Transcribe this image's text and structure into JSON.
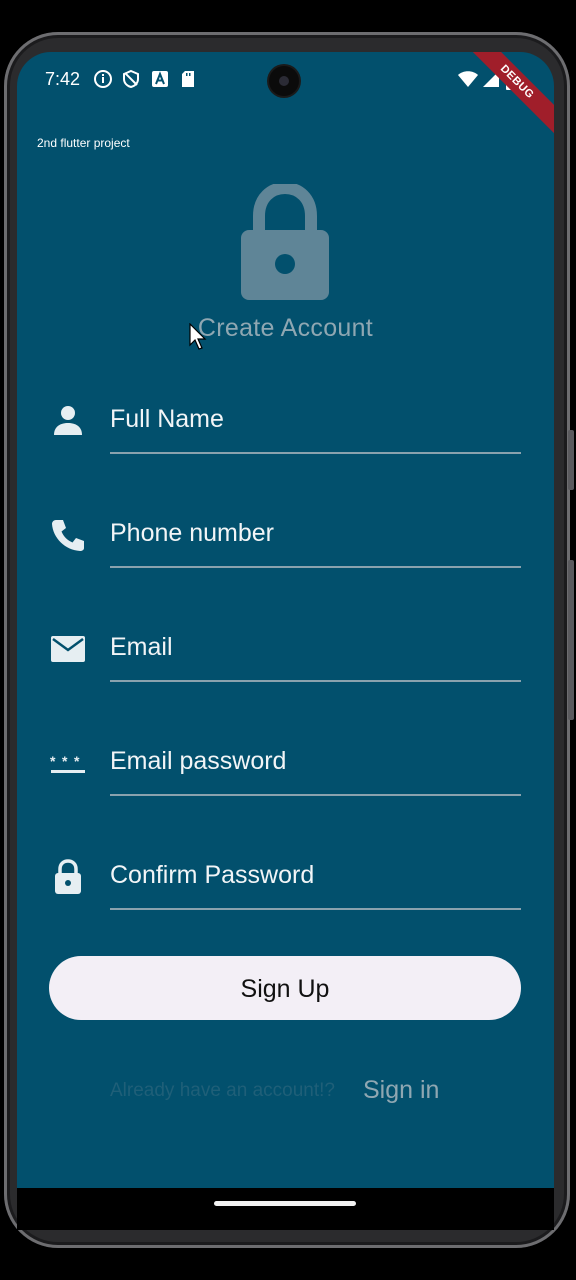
{
  "status_bar": {
    "time": "7:42",
    "left_icons": [
      "info-icon",
      "shield-icon",
      "a-icon",
      "sd-card-icon"
    ],
    "right_icons": [
      "wifi-icon",
      "signal-icon",
      "battery-icon"
    ]
  },
  "debug_banner": "DEBUG",
  "app": {
    "title": "2nd flutter project",
    "heading": "Create Account",
    "fields": [
      {
        "label": "Full Name",
        "icon": "person-icon"
      },
      {
        "label": "Phone number",
        "icon": "phone-icon"
      },
      {
        "label": "Email",
        "icon": "email-icon"
      },
      {
        "label": "Email password",
        "icon": "password-icon"
      },
      {
        "label": "Confirm Password",
        "icon": "lock-icon"
      }
    ],
    "signup_label": "Sign Up",
    "already_text": "Already have an account!?",
    "signin_label": "Sign in"
  },
  "colors": {
    "background": "#02506d",
    "text_muted": "#8fa7b2",
    "button_bg": "#f3eff6",
    "debug_banner": "#a01e2a"
  }
}
